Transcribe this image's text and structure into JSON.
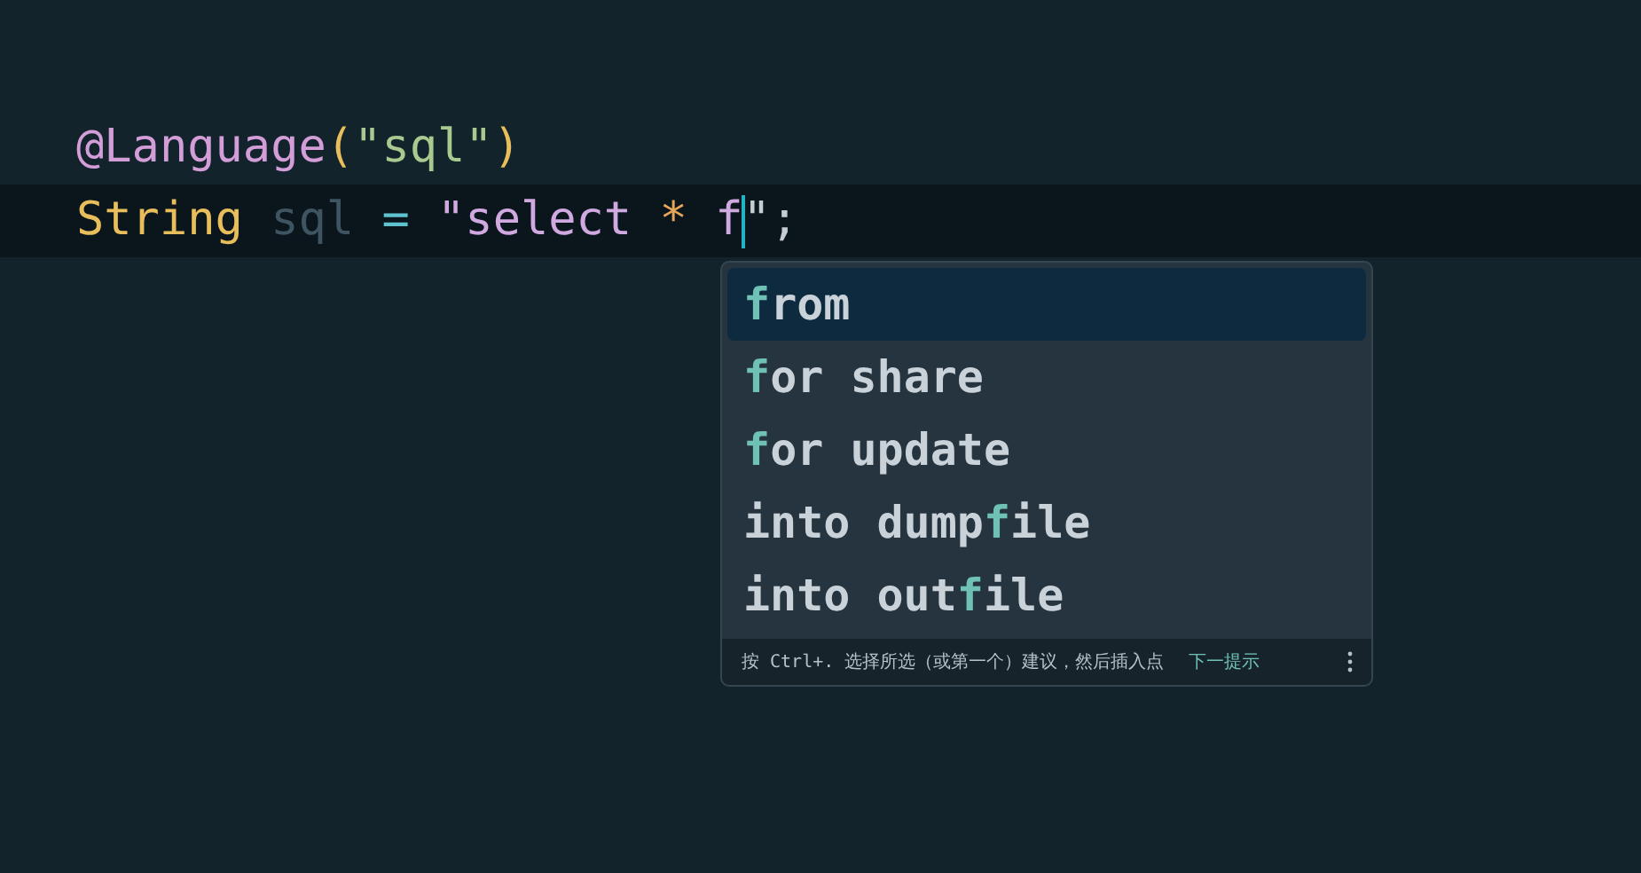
{
  "editor": {
    "lines": [
      {
        "tokens": [
          {
            "text": "@Language",
            "color": "#d39ed8"
          },
          {
            "text": "(",
            "color": "#e8bd5b"
          },
          {
            "text": "\"sql\"",
            "color": "#a8c98f"
          },
          {
            "text": ")",
            "color": "#e8bd5b"
          }
        ]
      },
      {
        "current": true,
        "tokens": [
          {
            "text": "String ",
            "color": "#e8bd5b"
          },
          {
            "text": "sql ",
            "color": "#3e5561"
          },
          {
            "text": "= ",
            "color": "#5fc2cf"
          },
          {
            "text": "\"select ",
            "color": "#cfa9e0"
          },
          {
            "text": "* ",
            "color": "#e8a65b"
          },
          {
            "text": "f",
            "color": "#cfa9e0",
            "caret_after": true
          },
          {
            "text": "\";",
            "color": "#c5ccd3"
          }
        ]
      }
    ]
  },
  "completion_popup": {
    "items": [
      {
        "selected": true,
        "parts": [
          {
            "text": "f",
            "match": true
          },
          {
            "text": "rom",
            "match": false
          }
        ]
      },
      {
        "selected": false,
        "parts": [
          {
            "text": "f",
            "match": true
          },
          {
            "text": "or share",
            "match": false
          }
        ]
      },
      {
        "selected": false,
        "parts": [
          {
            "text": "f",
            "match": true
          },
          {
            "text": "or update",
            "match": false
          }
        ]
      },
      {
        "selected": false,
        "parts": [
          {
            "text": "into dump",
            "match": false
          },
          {
            "text": "f",
            "match": true
          },
          {
            "text": "ile",
            "match": false
          }
        ]
      },
      {
        "selected": false,
        "parts": [
          {
            "text": "into out",
            "match": false
          },
          {
            "text": "f",
            "match": true
          },
          {
            "text": "ile",
            "match": false
          }
        ]
      }
    ],
    "footer": {
      "hint": "按 Ctrl+. 选择所选（或第一个）建议，然后插入点",
      "link": "下一提示"
    }
  }
}
